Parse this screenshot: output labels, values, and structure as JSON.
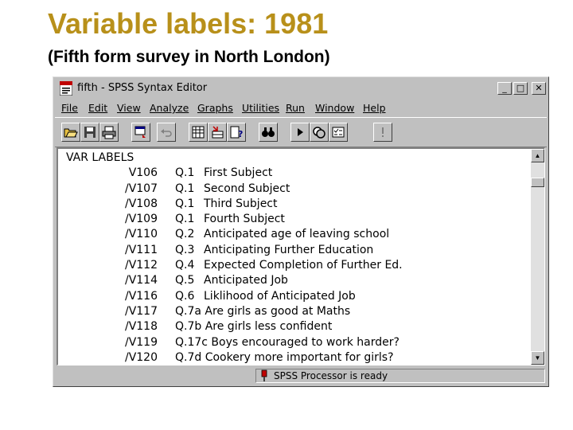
{
  "slide": {
    "title": "Variable labels: 1981",
    "subtitle": "(Fifth form survey in North London)"
  },
  "window": {
    "title": "fifth - SPSS Syntax Editor",
    "controls": {
      "minimize": "_",
      "maximize": "□",
      "close": "✕"
    }
  },
  "menu": [
    {
      "label": "File"
    },
    {
      "label": "Edit"
    },
    {
      "label": "View"
    },
    {
      "label": "Analyze"
    },
    {
      "label": "Graphs"
    },
    {
      "label": "Utilities"
    },
    {
      "label": "Run"
    },
    {
      "label": "Window"
    },
    {
      "label": "Help"
    }
  ],
  "toolbar": [
    "open-icon",
    "save-icon",
    "print-icon",
    "dialog-recall-icon",
    "undo-icon",
    "goto-data-icon",
    "goto-case-icon",
    "variables-icon",
    "find-icon",
    "run-icon",
    "use-sets-icon",
    "select-cases-icon",
    "help-icon"
  ],
  "editor": {
    "header": "VAR LABELS",
    "rows": [
      {
        "var": "V106",
        "q": "Q.1",
        "label": "First Subject"
      },
      {
        "var": "/V107",
        "q": "Q.1",
        "label": "Second Subject"
      },
      {
        "var": "/V108",
        "q": "Q.1",
        "label": "Third Subject"
      },
      {
        "var": "/V109",
        "q": "Q.1",
        "label": "Fourth Subject"
      },
      {
        "var": "/V110",
        "q": "Q.2",
        "label": "Anticipated age of leaving school"
      },
      {
        "var": "/V111",
        "q": "Q.3",
        "label": "Anticipating Further Education"
      },
      {
        "var": "/V112",
        "q": "Q.4",
        "label": "Expected Completion of Further Ed."
      },
      {
        "var": "/V114",
        "q": "Q.5",
        "label": "Anticipated Job"
      },
      {
        "var": "/V116",
        "q": "Q.6",
        "label": "Liklihood of Anticipated Job"
      },
      {
        "var": "/V117",
        "full": "Q.7a Are girls as good at Maths"
      },
      {
        "var": "/V118",
        "full": "Q.7b Are girls less confident"
      },
      {
        "var": "/V119",
        "full": "Q.17c Boys encouraged to work harder?"
      },
      {
        "var": "/V120",
        "full": "Q.7d Cookery more important for girls?"
      }
    ]
  },
  "status": {
    "text": "SPSS Processor  is ready"
  },
  "colors": {
    "title": "#b8901a",
    "window": "#c0c0c0"
  }
}
